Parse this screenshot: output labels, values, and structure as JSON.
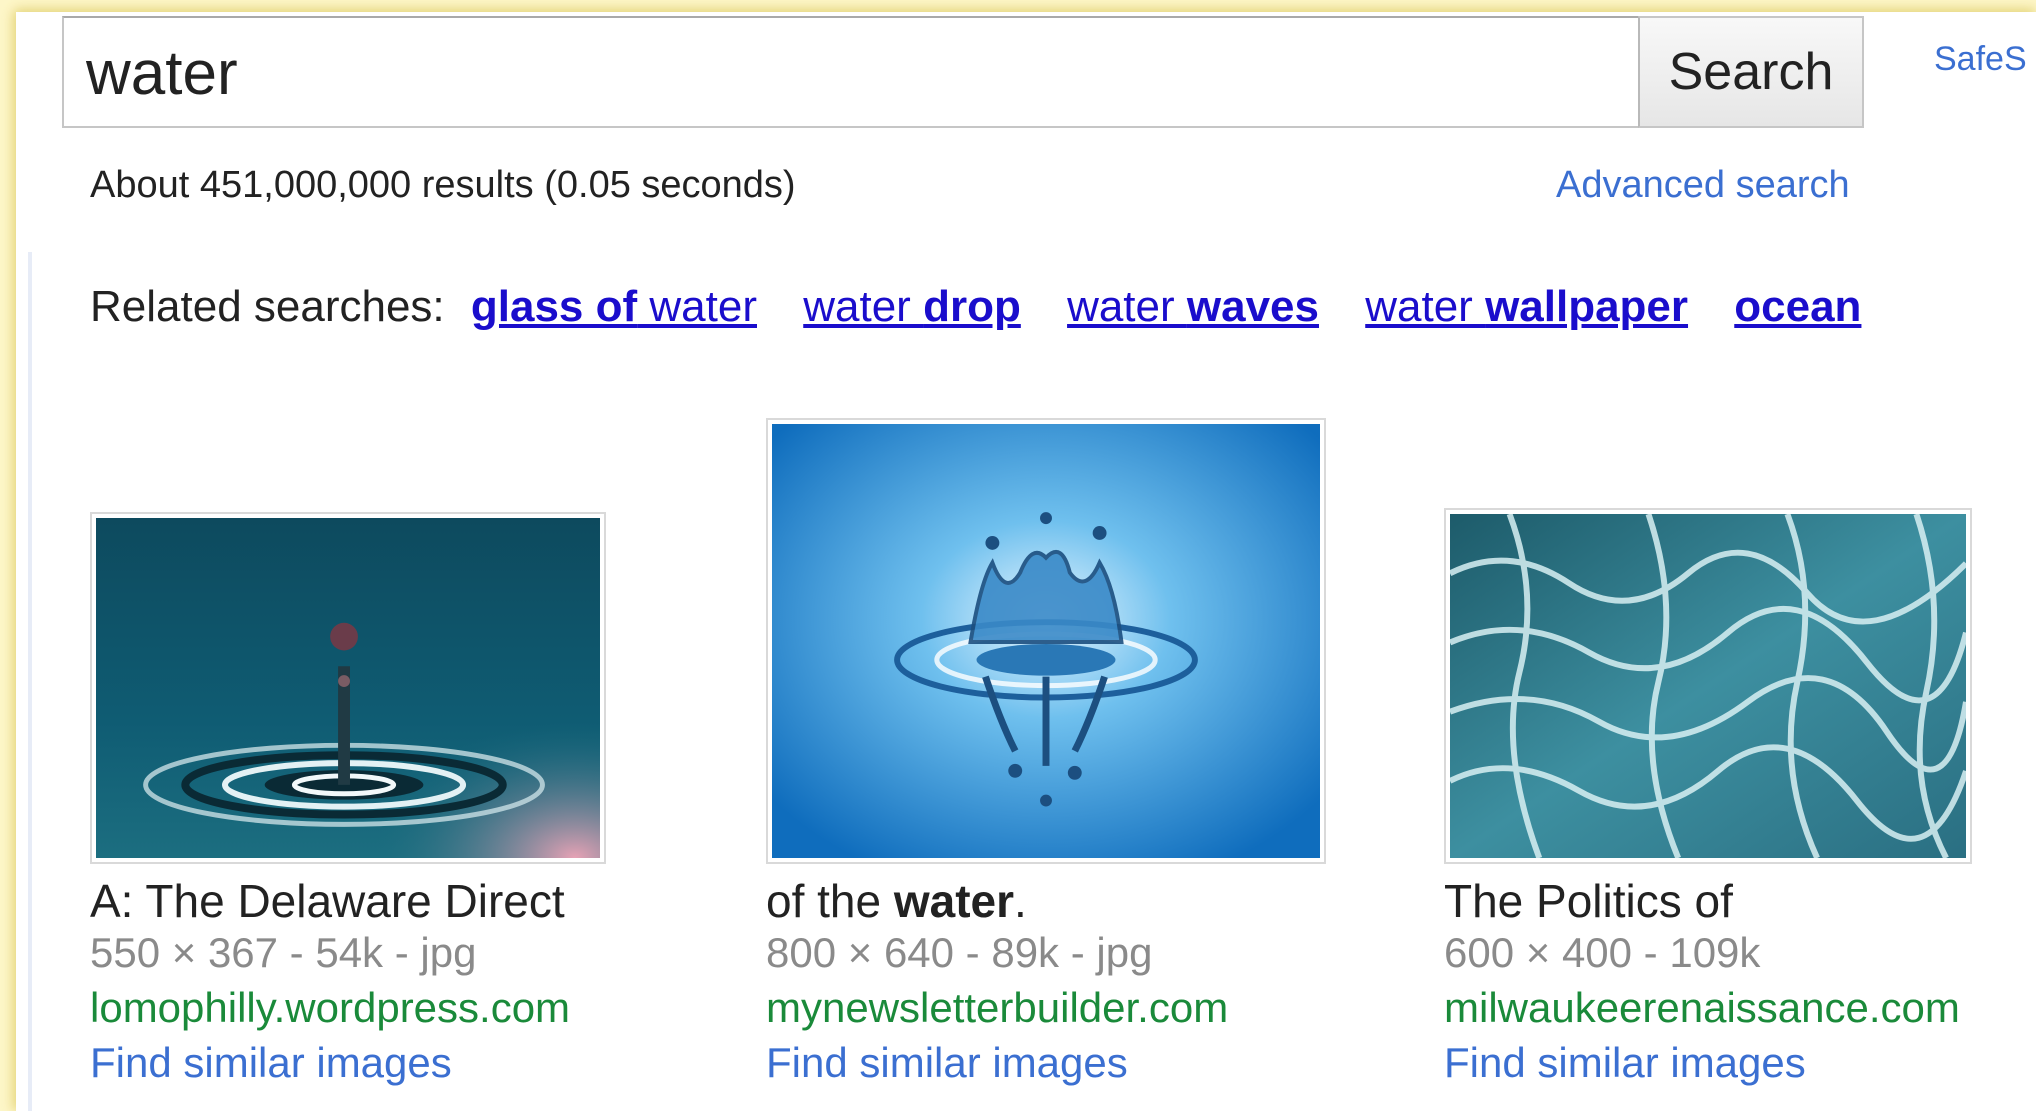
{
  "search": {
    "query": "water",
    "button_label": "Search",
    "safesearch_label": "SafeS",
    "result_stats": "About 451,000,000 results (0.05 seconds)",
    "advanced_search_label": "Advanced search"
  },
  "related": {
    "label": "Related searches:",
    "items": [
      {
        "bold": "glass of",
        "normal": " water"
      },
      {
        "normal": "water ",
        "bold": "drop"
      },
      {
        "normal": "water ",
        "bold": "waves"
      },
      {
        "normal": "water ",
        "bold": "wallpaper"
      },
      {
        "normal": "",
        "bold": "ocean"
      }
    ]
  },
  "results": [
    {
      "title": "A: The Delaware Direct",
      "meta": "550 × 367 - 54k - jpg",
      "domain": "lomophilly.wordpress.com",
      "similar_label": "Find similar images",
      "image_icon": "water-drop-ripple-image"
    },
    {
      "title_normal": "of the ",
      "title_bold": "water",
      "title_end": ".",
      "meta": "800 × 640 - 89k - jpg",
      "domain": "mynewsletterbuilder.com",
      "similar_label": "Find similar images",
      "image_icon": "water-splash-crown-image"
    },
    {
      "title": "The Politics of",
      "meta": "600 × 400 - 109k",
      "domain": "milwaukeerenaissance.com",
      "similar_label": "Find similar images",
      "image_icon": "pool-water-caustics-image"
    }
  ],
  "colors": {
    "link_blue": "#3b6fd1",
    "related_link": "#1a0dcc",
    "domain_green": "#1a8a3a",
    "meta_gray": "#8a8a8a",
    "page_outer": "#fdf6c8"
  }
}
